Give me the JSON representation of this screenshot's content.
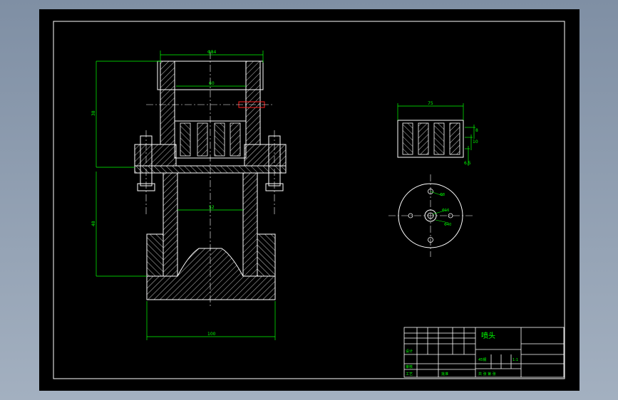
{
  "colors": {
    "background": "#8a9aae",
    "sheet": "#000000",
    "outline": "#ffffff",
    "dimension": "#00ff00",
    "centerline": "#ffffff",
    "hatch": "#ffffff",
    "accent_red": "#ff2020"
  },
  "dimensions": {
    "top_width": "Φ84",
    "inner_width": "60",
    "upper_height": "38",
    "lower_height": "48",
    "mid_width": "52",
    "base_width": "100",
    "side_width": "75",
    "side_h1": "8",
    "side_h2": "10",
    "side_h3": "6.5",
    "hole_small": "Φ8",
    "hole_center": "Φ16",
    "hole_pcd": "Φ40"
  },
  "title_block": {
    "part_name": "喷头",
    "material": "45钢",
    "scale": "1:1",
    "designer": "设计",
    "checker": "审核",
    "process": "工艺",
    "approve": "批准",
    "sheets": "共  张  第  张"
  }
}
